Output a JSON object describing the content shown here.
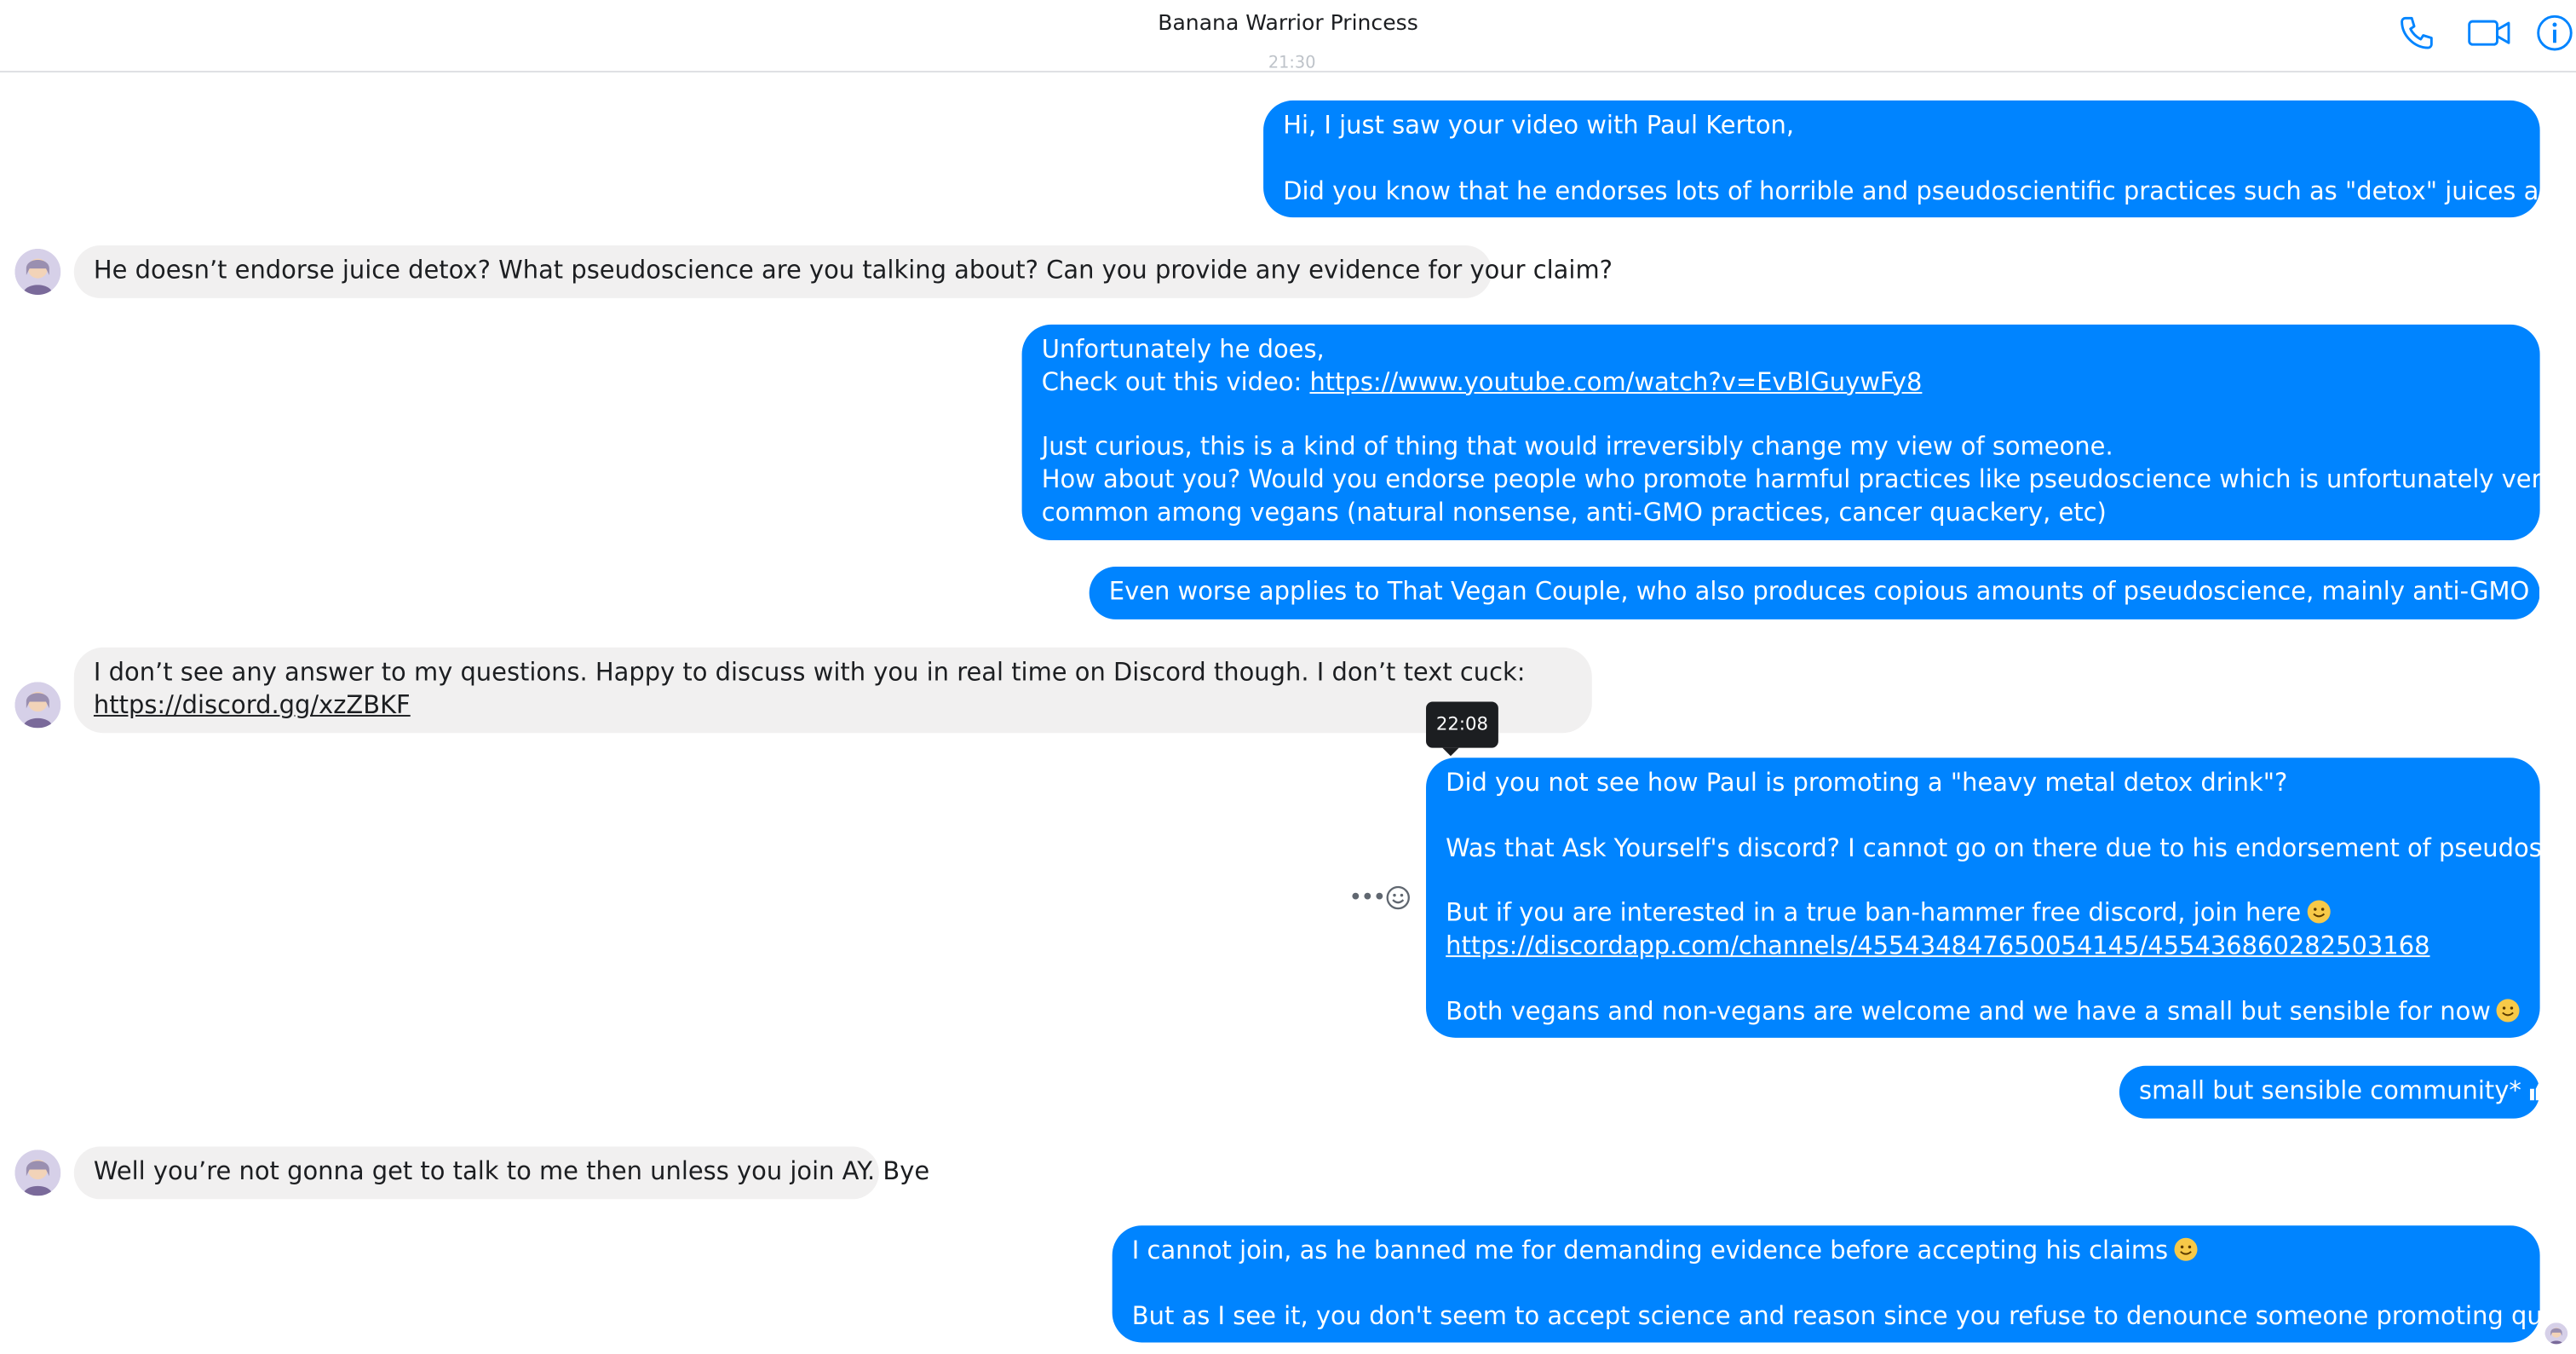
{
  "header": {
    "title": "Banana Warrior Princess",
    "icons": [
      "phone-icon",
      "video-camera-icon",
      "info-icon"
    ],
    "accent_color": "#0084ff"
  },
  "cut_label": "21:30",
  "messages": [
    {
      "id": "m1",
      "direction": "outgoing",
      "lines": [
        "Hi, I just saw your video with Paul Kerton,",
        "",
        "Did you know that he endorses lots of horrible and pseudoscientific practices such as \"detox\" juices and such?"
      ]
    },
    {
      "id": "m2",
      "direction": "incoming",
      "lines": [
        "He doesn’t endorse juice detox? What pseudoscience are you talking about? Can you provide any evidence for your claim?"
      ]
    },
    {
      "id": "m3",
      "direction": "outgoing",
      "lines": [
        "Unfortunately he does,",
        "Check out this video: ",
        "",
        "Just curious, this is a kind of thing that would irreversibly change my view of someone.",
        "How about you? Would you endorse people who promote harmful practices like pseudoscience which is unfortunately very",
        "common among vegans (natural nonsense, anti-GMO practices, cancer quackery, etc)"
      ],
      "link": "https://www.youtube.com/watch?v=EvBlGuywFy8"
    },
    {
      "id": "m4",
      "direction": "outgoing",
      "lines": [
        "Even worse applies to That Vegan Couple, who also produces copious amounts of pseudoscience, mainly anti-GMO nonsense"
      ]
    },
    {
      "id": "m5",
      "direction": "incoming",
      "lines": [
        "I don’t see any answer to my questions. Happy to discuss with you in real time on Discord though. I don’t text cuck:"
      ],
      "link": "https://discord.gg/xzZBKF"
    },
    {
      "id": "m6",
      "direction": "outgoing",
      "lines": [
        "Did you not see how Paul is promoting a \"heavy metal detox drink\"?",
        "",
        "Was that Ask Yourself's discord? I cannot go on there due to his endorsement of pseudoscience",
        "",
        "But if you are interested in a true ban-hammer free discord, join here",
        "",
        "",
        "Both vegans and non-vegans are welcome and we have a small but sensible for now"
      ],
      "link": "https://discordapp.com/channels/455434847650054145/455436860282503168",
      "timestamp": "22:08"
    },
    {
      "id": "m7",
      "direction": "outgoing",
      "lines": [
        "small but sensible community*"
      ]
    },
    {
      "id": "m8",
      "direction": "incoming",
      "lines": [
        "Well you’re not gonna get to talk to me then unless you join AY. Bye"
      ]
    },
    {
      "id": "m9",
      "direction": "outgoing",
      "lines": [
        "I cannot join, as he banned me for demanding evidence before accepting his claims",
        "",
        "But as I see it, you don't seem to accept science and reason since you refuse to denounce someone promoting quackery"
      ]
    }
  ],
  "hover_actions": {
    "more": "•••"
  }
}
